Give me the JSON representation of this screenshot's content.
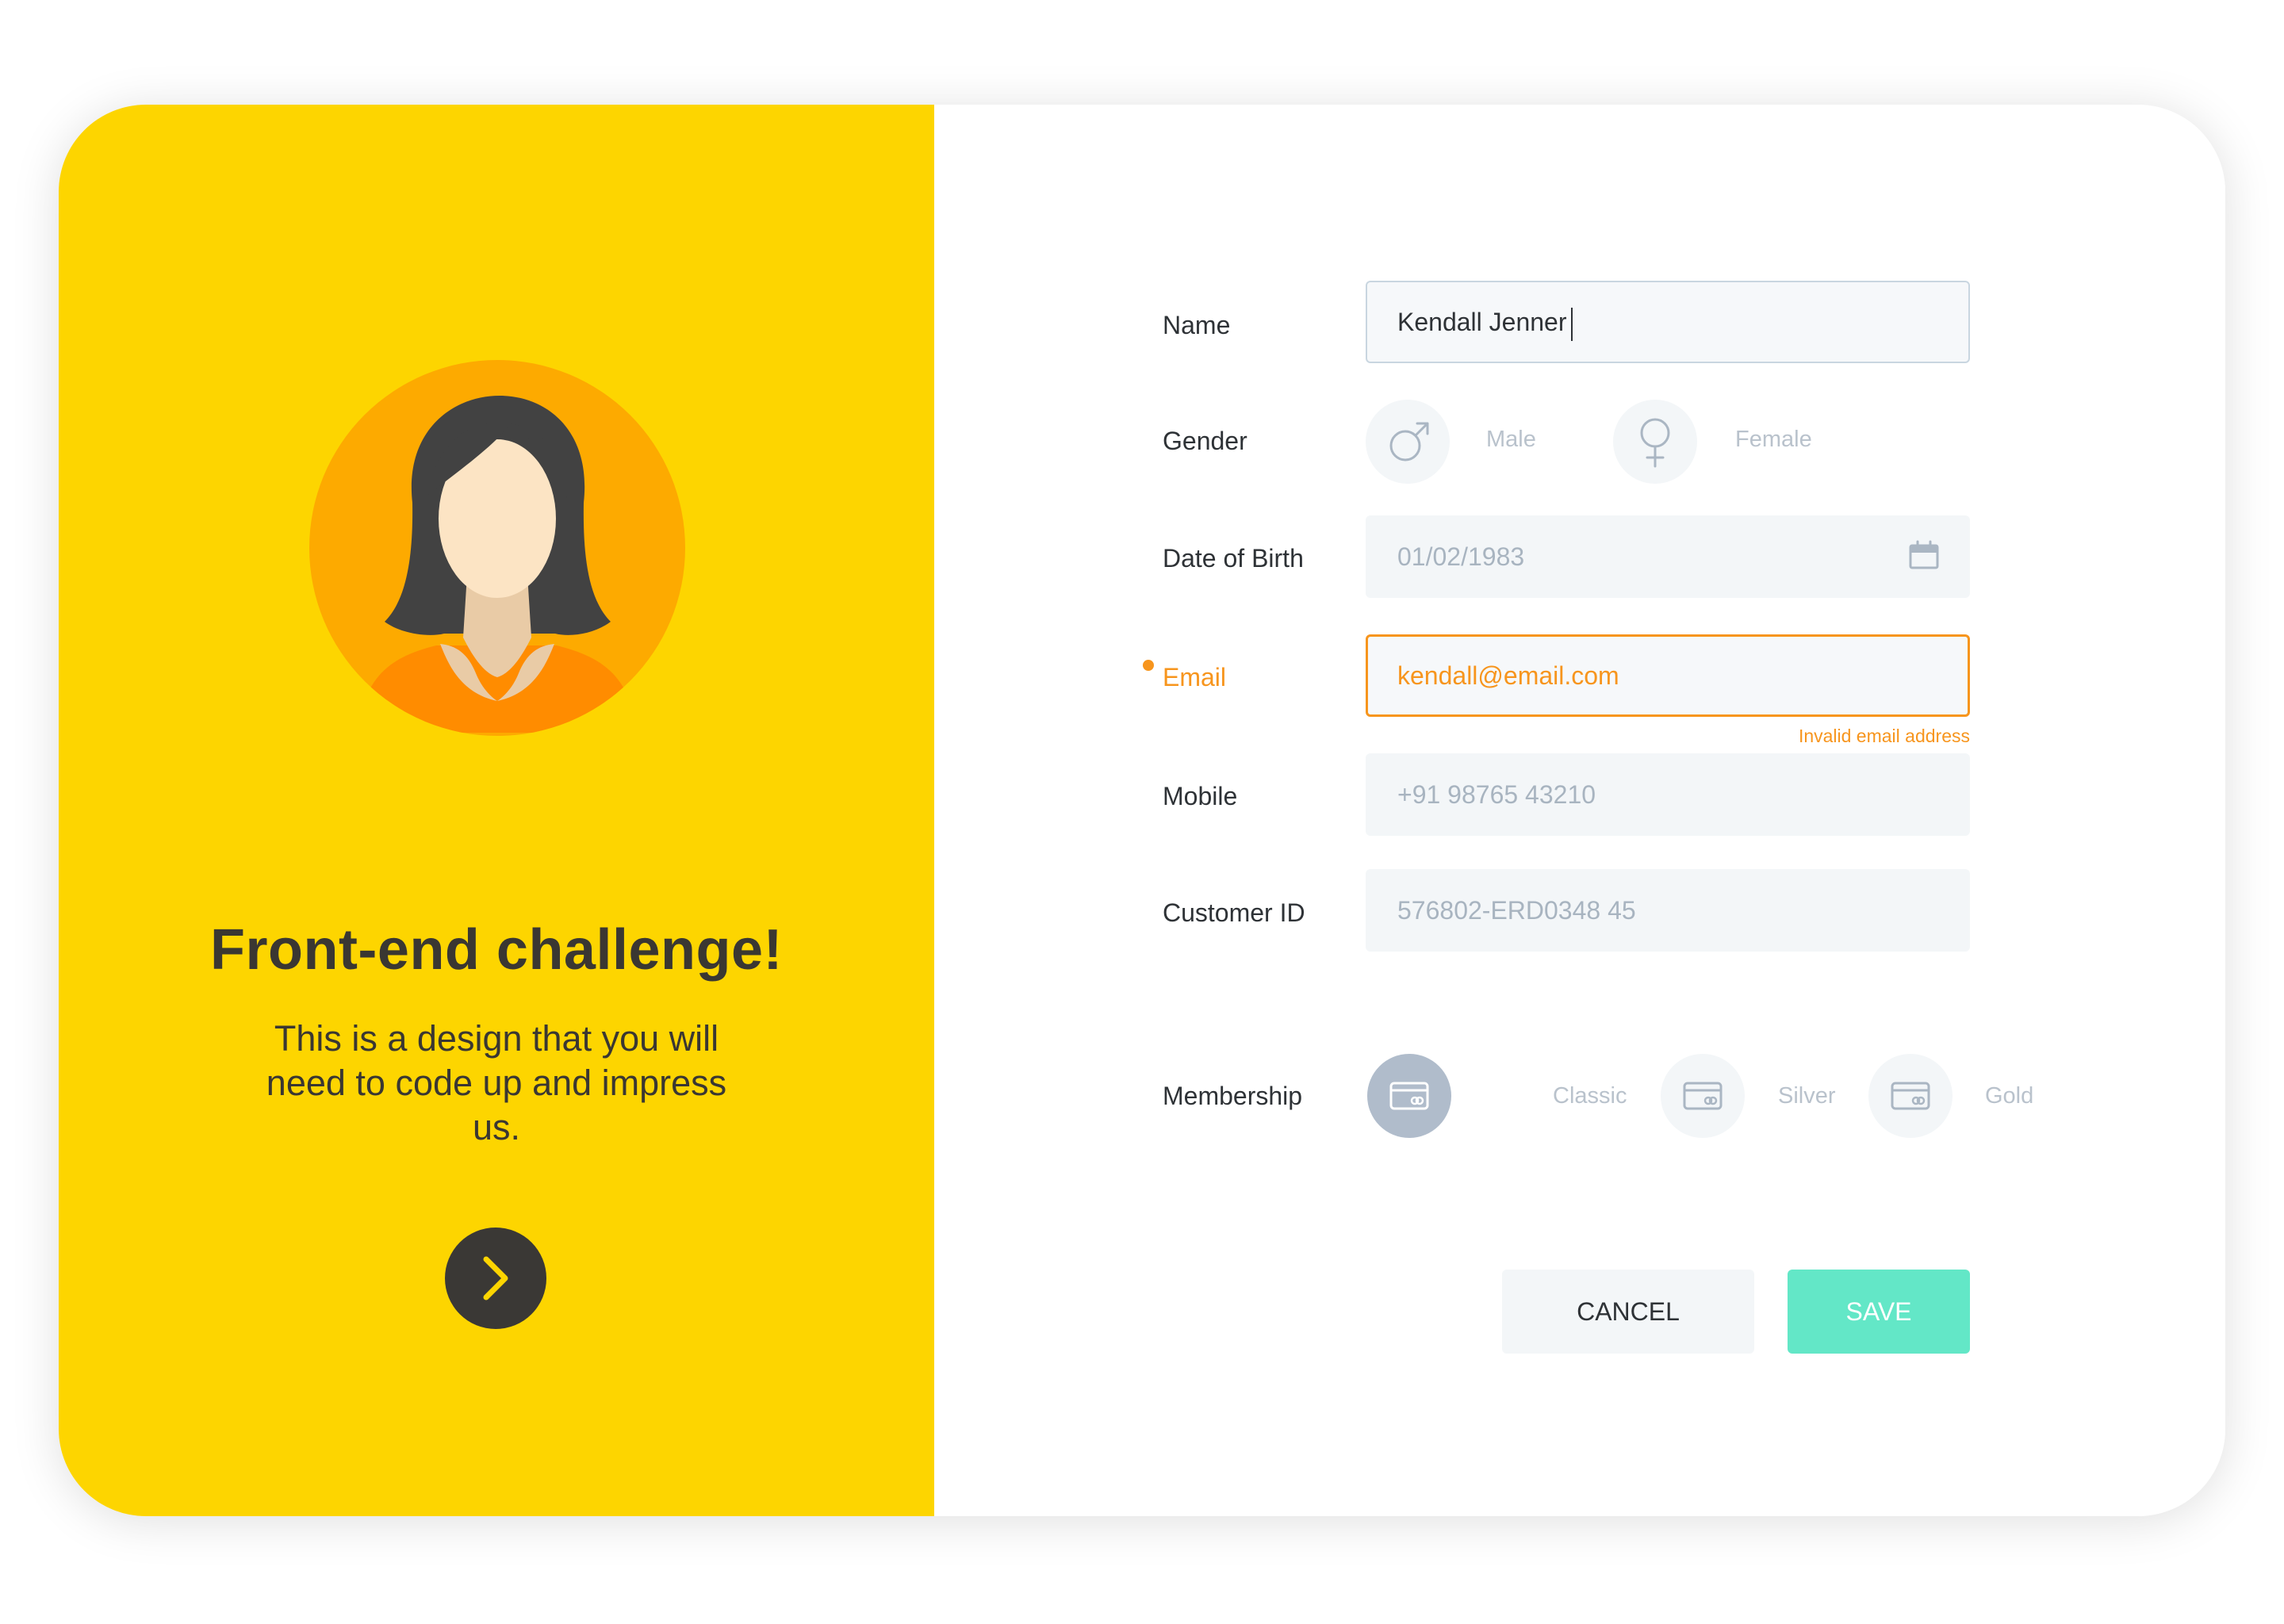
{
  "intro": {
    "title": "Front-end challenge!",
    "description": "This is a design that you will need to code up and impress us."
  },
  "icons": {
    "next": "chevron-right-icon",
    "male": "male-symbol-icon",
    "female": "female-symbol-icon",
    "calendar": "calendar-icon",
    "card": "credit-card-icon",
    "avatar": "woman-avatar-icon"
  },
  "form": {
    "name": {
      "label": "Name",
      "value": "Kendall Jenner"
    },
    "gender": {
      "label": "Gender",
      "options": [
        {
          "label": "Male"
        },
        {
          "label": "Female"
        }
      ]
    },
    "dob": {
      "label": "Date of Birth",
      "value": "01/02/1983"
    },
    "email": {
      "label": "Email",
      "value": "kendall@email.com",
      "error": "Invalid email address"
    },
    "mobile": {
      "label": "Mobile",
      "value": "+91 98765 43210"
    },
    "customer_id": {
      "label": "Customer ID",
      "value": "576802-ERD0348 45"
    },
    "membership": {
      "label": "Membership",
      "selected": "Classic",
      "options": [
        {
          "label": "Classic"
        },
        {
          "label": "Silver"
        },
        {
          "label": "Gold"
        }
      ]
    }
  },
  "actions": {
    "cancel_label": "CANCEL",
    "save_label": "SAVE"
  },
  "colors": {
    "left_panel": "#FDD500",
    "avatar_circle": "#FDAA00",
    "accent_error": "#F7951D",
    "save_button": "#63E7C7",
    "selected_option": "#B0BCCB",
    "text_dark": "#3A3732"
  }
}
